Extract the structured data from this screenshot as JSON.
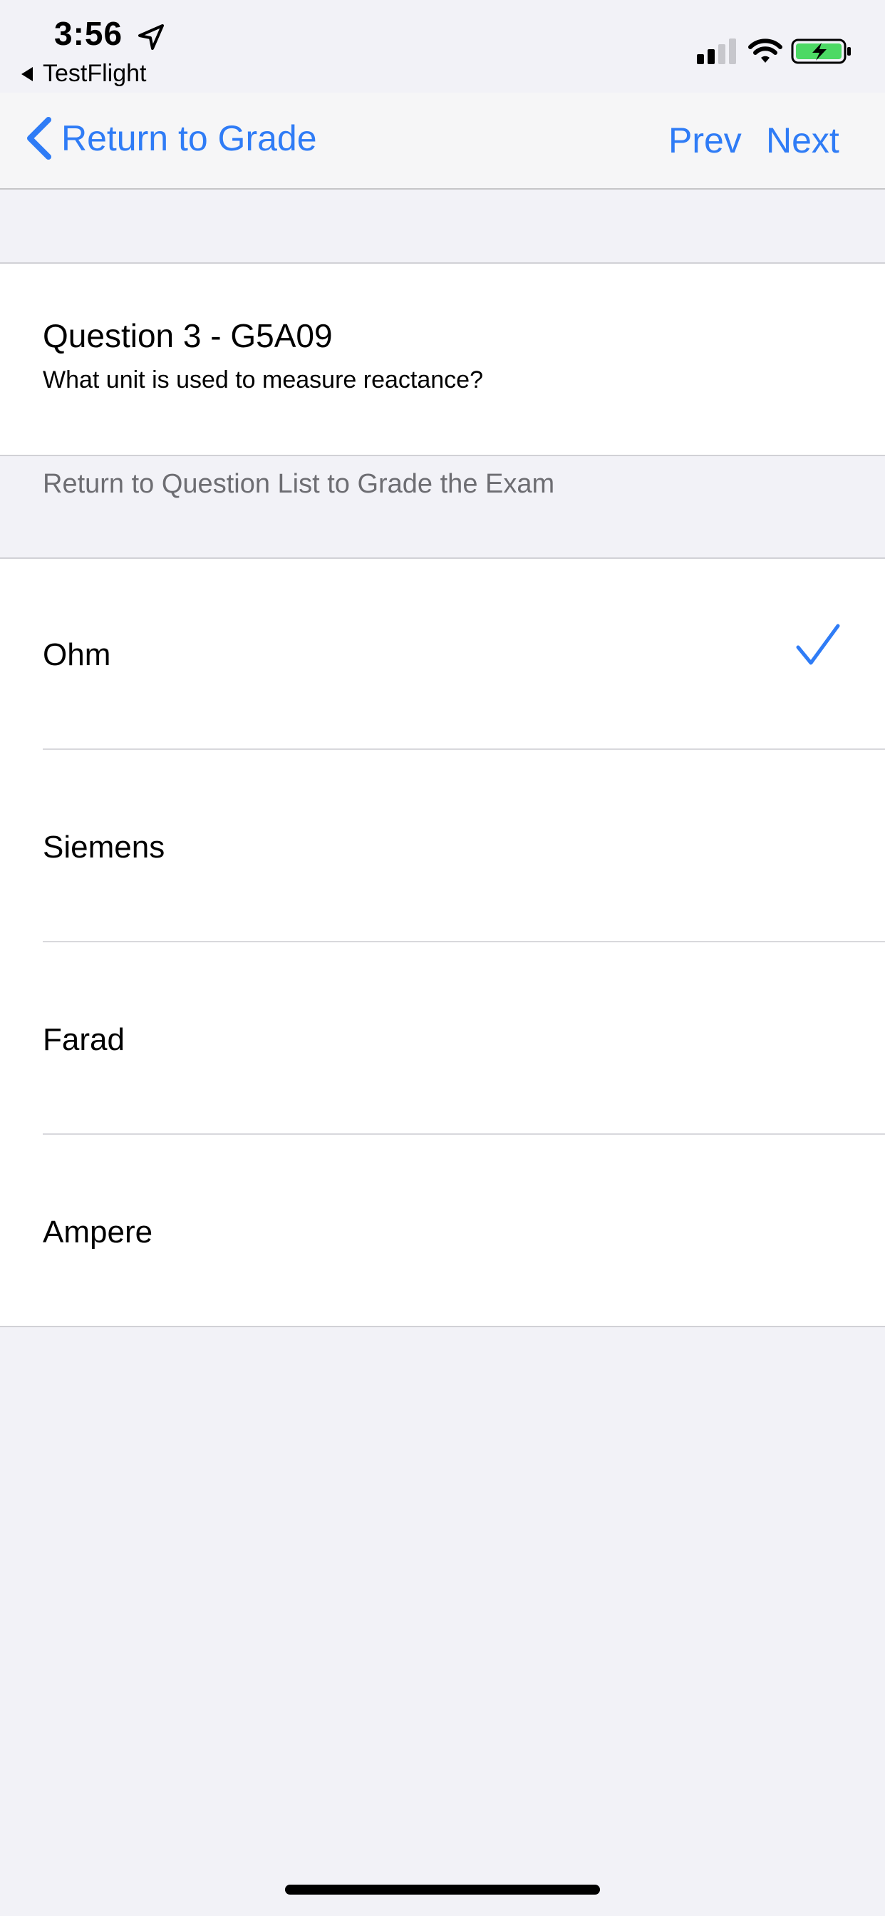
{
  "status_bar": {
    "time": "3:56",
    "back_app_label": "TestFlight",
    "location_icon": "location-arrow-icon",
    "signal_icon": "cellular-signal-icon",
    "wifi_icon": "wifi-icon",
    "battery_icon": "battery-charging-icon"
  },
  "nav": {
    "back_label": "Return to Grade",
    "prev_label": "Prev",
    "next_label": "Next",
    "accent_color": "#2f7cf6"
  },
  "question": {
    "title": "Question 3 - G5A09",
    "text": "What unit is used to measure reactance?"
  },
  "section": {
    "header": "Return to Question List to Grade the Exam"
  },
  "answers": [
    {
      "label": "Ohm",
      "selected": true
    },
    {
      "label": "Siemens",
      "selected": false
    },
    {
      "label": "Farad",
      "selected": false
    },
    {
      "label": "Ampere",
      "selected": false
    }
  ]
}
